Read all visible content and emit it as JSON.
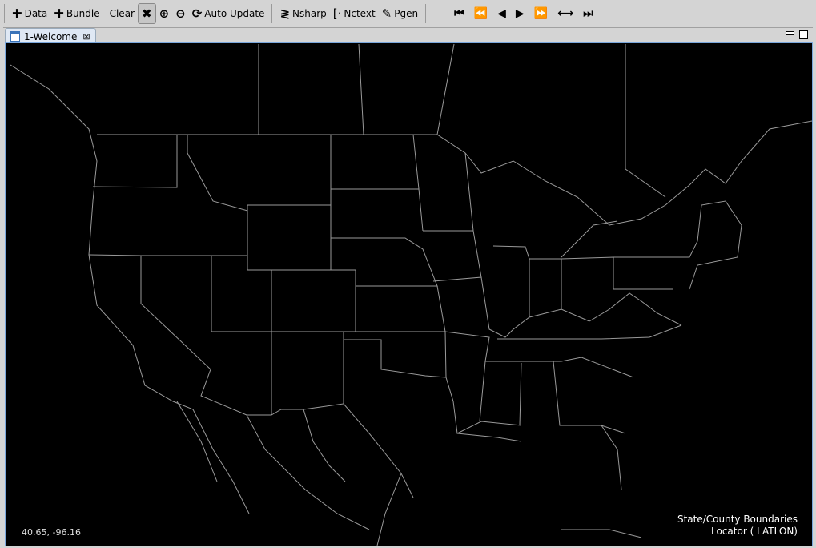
{
  "toolbar": {
    "data": "Data",
    "bundle": "Bundle",
    "clear": "Clear",
    "auto_update": "Auto Update",
    "nsharp": "Nsharp",
    "nctext": "Nctext",
    "pgen": "Pgen"
  },
  "tab": {
    "label": "1-Welcome"
  },
  "map": {
    "coordinates": "40.65, -96.16",
    "legend": [
      "State/County Boundaries",
      "Locator ( LATLON)"
    ],
    "line_color": "#9a9a9a",
    "background": "#000000"
  }
}
